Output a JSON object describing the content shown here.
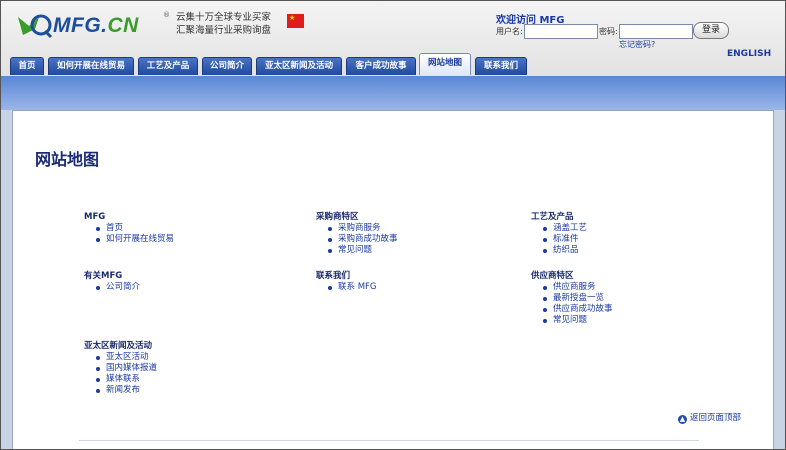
{
  "header": {
    "logo_main": "MFG.",
    "logo_cn": "CN",
    "logo_reg": "®",
    "slogan_line1": "云集十万全球专业买家",
    "slogan_line2": "汇聚海量行业采购询盘",
    "flag_icon": "china-flag-icon",
    "welcome": "欢迎访问 MFG",
    "username_label": "用户名:",
    "username_value": "",
    "password_label": "密码:",
    "password_value": "",
    "login_button": "登录",
    "forgot_password": "忘记密码?",
    "english_link": "ENGLISH"
  },
  "nav": {
    "tabs": [
      {
        "label": "首页",
        "active": false
      },
      {
        "label": "如何开展在线贸易",
        "active": false
      },
      {
        "label": "工艺及产品",
        "active": false
      },
      {
        "label": "公司简介",
        "active": false
      },
      {
        "label": "亚太区新闻及活动",
        "active": false
      },
      {
        "label": "客户成功故事",
        "active": false
      },
      {
        "label": "网站地图",
        "active": true
      },
      {
        "label": "联系我们",
        "active": false
      }
    ]
  },
  "main": {
    "title": "网站地图",
    "sections": [
      {
        "title": "MFG",
        "items": [
          "首页",
          "如何开展在线贸易"
        ]
      },
      {
        "title": "采购商特区",
        "items": [
          "采购商服务",
          "采购商成功故事",
          "常见问题"
        ]
      },
      {
        "title": "工艺及产品",
        "items": [
          "涵盖工艺",
          "标准件",
          "纺织品"
        ]
      },
      {
        "title": "有关MFG",
        "items": [
          "公司简介"
        ]
      },
      {
        "title": "联系我们",
        "items": [
          "联系 MFG"
        ]
      },
      {
        "title": "供应商特区",
        "items": [
          "供应商服务",
          "最新授盘一览",
          "供应商成功故事",
          "常见问题"
        ]
      },
      {
        "title": "亚太区新闻及活动",
        "items": [
          "亚太区活动",
          "国内媒体报道",
          "媒体联系",
          "新闻发布"
        ]
      }
    ],
    "back_to_top": "返回页面顶部"
  },
  "colors": {
    "brand_blue": "#1d4e9a",
    "brand_green": "#3a9a2a",
    "tab_blue": "#1f4a9e",
    "link_blue": "#1a3aa0"
  }
}
